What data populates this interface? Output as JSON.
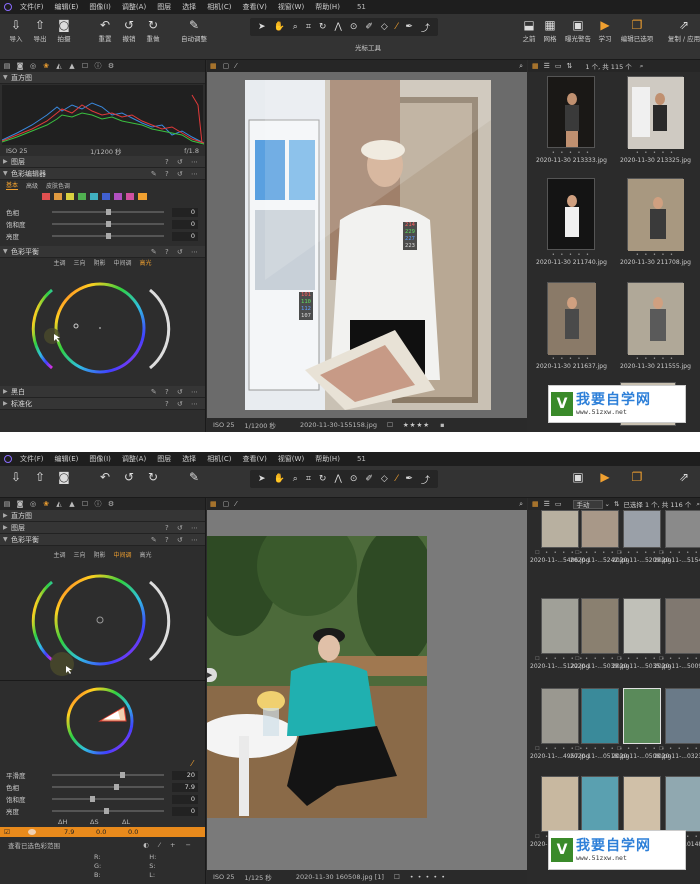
{
  "menu": [
    "文件(F)",
    "编辑(E)",
    "图像(I)",
    "调整(A)",
    "图层",
    "选择",
    "相机(C)",
    "查看(V)",
    "视窗(W)",
    "帮助(H)"
  ],
  "window_title": "51",
  "toolbar": {
    "left": [
      {
        "icon": "import-icon",
        "label": "导入"
      },
      {
        "icon": "export-icon",
        "label": "导出"
      },
      {
        "icon": "camera-icon",
        "label": "拍摄"
      },
      {
        "icon": "reset-icon",
        "label": "重置"
      },
      {
        "icon": "undo-icon",
        "label": "撤销"
      },
      {
        "icon": "redo-icon",
        "label": "重做"
      },
      {
        "icon": "auto-adjust-icon",
        "label": "自动调整"
      }
    ],
    "cursor_tools_label": "光标工具",
    "right": [
      {
        "icon": "before-icon",
        "label": "之前"
      },
      {
        "icon": "grid-icon",
        "label": "网格"
      },
      {
        "icon": "exposure-warning-icon",
        "label": "曝光警告"
      },
      {
        "icon": "learn-icon",
        "label": "学习"
      },
      {
        "icon": "edit-selected-icon",
        "label": "编辑已选项"
      },
      {
        "icon": "copy-apply-icon",
        "label": "复制 / 应用"
      }
    ]
  },
  "screen1": {
    "histogram": {
      "title": "直方图",
      "iso": "ISO 25",
      "shutter": "1/1200 秒",
      "aperture": "f/1.8"
    },
    "layers": "图层",
    "color_editor": {
      "title": "色彩编辑器",
      "tabs": [
        "基本",
        "高级",
        "皮肤色调"
      ],
      "sliders": [
        {
          "label": "色相",
          "value": "0"
        },
        {
          "label": "饱和度",
          "value": "0"
        },
        {
          "label": "亮度",
          "value": "0"
        }
      ]
    },
    "color_balance": {
      "title": "色彩平衡",
      "tabs": [
        "主调",
        "三向",
        "阴影",
        "中间调",
        "高光"
      ]
    },
    "bw": "黑白",
    "normalize": "标准化",
    "browser_count": "1 个, 共 115 个",
    "readout_a": [
      "214",
      "229",
      "227",
      "223"
    ],
    "readout_b": [
      "101",
      "110",
      "112",
      "107"
    ],
    "footer": {
      "iso": "ISO 25",
      "shutter": "1/1200 秒",
      "file": "2020-11-30-155158.jpg",
      "stars": "★★★★"
    },
    "thumbs": [
      "2020-11-30 213333.jpg",
      "2020-11-30 213325.jpg",
      "2020-11-30 211740.jpg",
      "2020-11-30 211708.jpg",
      "2020-11-30 211637.jpg",
      "2020-11-30 211555.jpg"
    ]
  },
  "screen2": {
    "histogram": "直方图",
    "layers": "图层",
    "color_balance": {
      "title": "色彩平衡",
      "tabs": [
        "主调",
        "三向",
        "阴影",
        "中间调",
        "高光"
      ]
    },
    "sliders": [
      {
        "label": "平滑度",
        "value": "20"
      },
      {
        "label": "色相",
        "value": "7.9"
      },
      {
        "label": "饱和度",
        "value": "0"
      },
      {
        "label": "亮度",
        "value": "0"
      }
    ],
    "delta_headers": [
      "ΔH",
      "ΔS",
      "ΔL"
    ],
    "delta_values": [
      "7.9",
      "0.0",
      "0.0"
    ],
    "view_range": "查看已选色彩范围",
    "rgb": [
      "R:",
      "G:",
      "B:"
    ],
    "hsl": [
      "H:",
      "S:",
      "L:"
    ],
    "filter": "手动",
    "browser_count": "已选择 1 个, 共 116 个",
    "footer": {
      "iso": "ISO 25",
      "shutter": "1/125 秒",
      "file": "2020-11-30 160508.jpg [1]"
    },
    "thumbs": [
      "2020-11-...5406.jpg",
      "2020-11-...5242.jpg",
      "2020-11-...5209.jpg",
      "2020-11-...5154.jpg",
      "2020-11-...5122.jpg",
      "2020-11-...5039.jpg",
      "2020-11-...5035.jpg",
      "2020-11-...5009.jpg",
      "2020-11-...4957.jpg",
      "2020-11-...0518.jpg",
      "2020-11-...0508.jpg",
      "2020-11-...0323.jpg",
      "2020-11-...0243.jpg",
      "2020-11-...0214.jpg",
      "2020-11-...0205.jpg",
      "2020-11-...0148.jpg"
    ]
  },
  "watermark": {
    "title": "我要自学网",
    "url": "www.51zxw.net"
  }
}
